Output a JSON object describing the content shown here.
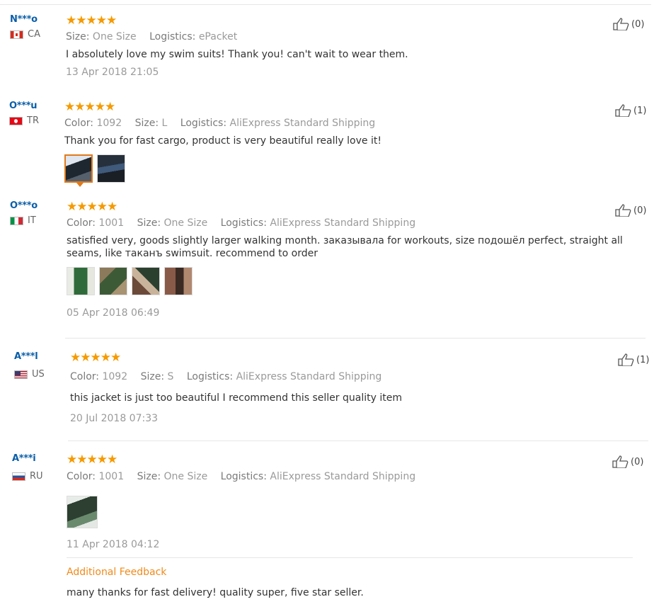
{
  "reviews": [
    {
      "user": "N***o",
      "country": "CA",
      "rating_label": "★★★★★",
      "rating": 5,
      "meta": [
        {
          "key": "Size:",
          "value": "One Size"
        },
        {
          "key": "Logistics:",
          "value": "ePacket"
        }
      ],
      "text": "I absolutely love my swim suits! Thank you! can't wait to wear them.",
      "date": "13 Apr 2018 21:05",
      "likes": "(0)"
    },
    {
      "user": "O***u",
      "country": "TR",
      "rating_label": "★★★★★",
      "rating": 5,
      "meta": [
        {
          "key": "Color:",
          "value": "1092"
        },
        {
          "key": "Size:",
          "value": "L"
        },
        {
          "key": "Logistics:",
          "value": "AliExpress Standard Shipping"
        }
      ],
      "text": "Thank you for fast cargo, product is very beautiful really love it!",
      "likes": "(1)"
    },
    {
      "user": "O***o",
      "country": "IT",
      "rating_label": "★★★★★",
      "rating": 5,
      "meta": [
        {
          "key": "Color:",
          "value": "1001"
        },
        {
          "key": "Size:",
          "value": "One Size"
        },
        {
          "key": "Logistics:",
          "value": "AliExpress Standard Shipping"
        }
      ],
      "text": "satisfied very, goods slightly larger walking month. заказывала for workouts, size подошёл perfect, straight all seams, like таканъ swimsuit. recommend to order",
      "date": "05 Apr 2018 06:49",
      "likes": "(0)"
    },
    {
      "user": "A***l",
      "country": "US",
      "rating_label": "★★★★★",
      "rating": 5,
      "meta": [
        {
          "key": "Color:",
          "value": "1092"
        },
        {
          "key": "Size:",
          "value": "S"
        },
        {
          "key": "Logistics:",
          "value": "AliExpress Standard Shipping"
        }
      ],
      "text": "this jacket is just too beautiful I recommend this seller quality item",
      "date": "20 Jul 2018 07:33",
      "likes": "(1)"
    },
    {
      "user": "A***i",
      "country": "RU",
      "rating_label": "★★★★★",
      "rating": 5,
      "meta": [
        {
          "key": "Color:",
          "value": "1001"
        },
        {
          "key": "Size:",
          "value": "One Size"
        },
        {
          "key": "Logistics:",
          "value": "AliExpress Standard Shipping"
        }
      ],
      "text": "",
      "date": "11 Apr 2018 04:12",
      "likes": "(0)",
      "additional_feedback_label": "Additional Feedback",
      "additional_feedback_text": "many thanks for fast delivery! quality super, five star seller."
    }
  ],
  "colors": {
    "username": "#0a5ea8",
    "star": "#f59a00",
    "accent_orange": "#f08a1a",
    "muted_text": "#9a9a9a"
  },
  "icons": [
    "thumbs-up-icon",
    "flag-icon",
    "star-icon"
  ]
}
